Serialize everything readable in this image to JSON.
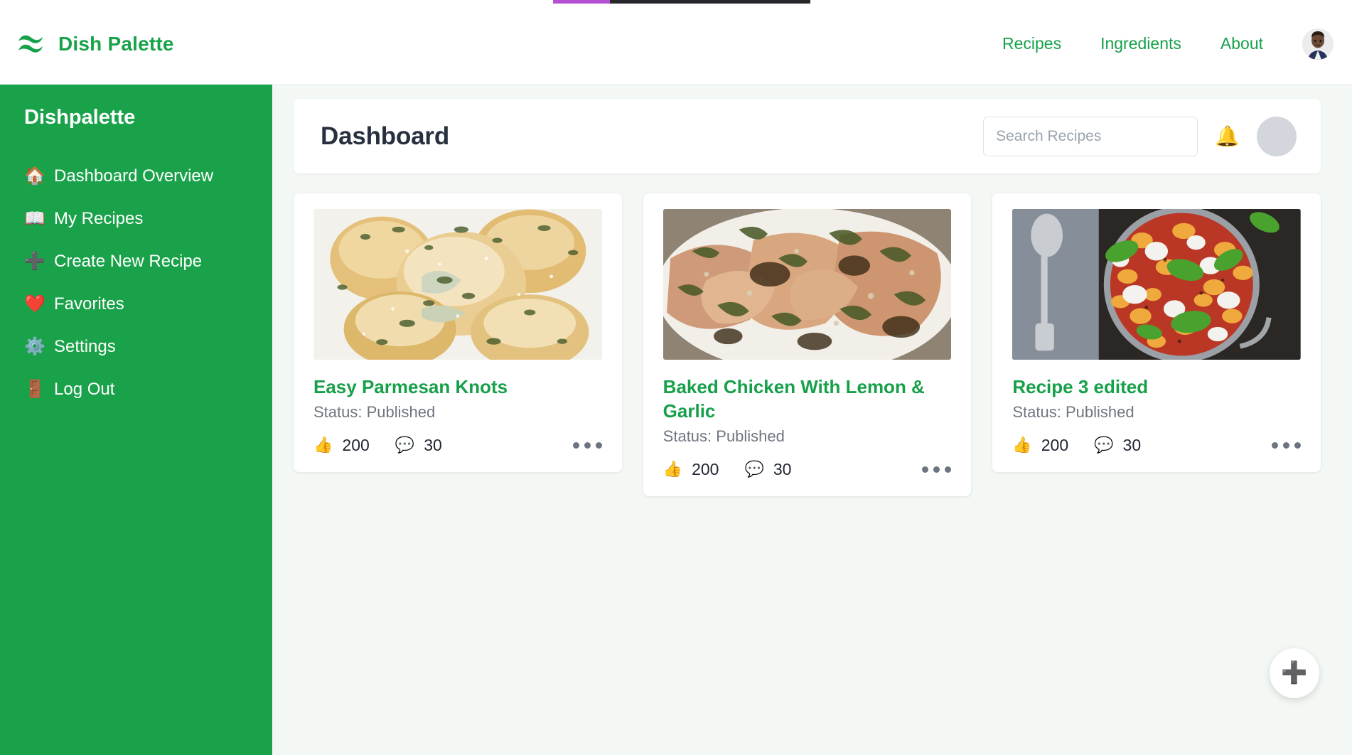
{
  "loading_bar": {
    "progress_percent": 22,
    "fill_color": "#b34fd0",
    "track_color": "#26262b"
  },
  "topnav": {
    "brand": "Dish Palette",
    "logo_icon": "wave-leaf-icon",
    "links": [
      {
        "label": "Recipes"
      },
      {
        "label": "Ingredients"
      },
      {
        "label": "About"
      }
    ],
    "avatar_icon": "user-photo-avatar"
  },
  "sidebar": {
    "title": "Dishpalette",
    "background_color": "#1aa24a",
    "items": [
      {
        "label": "Dashboard Overview",
        "icon": "house-icon",
        "glyph": "🏠"
      },
      {
        "label": "My Recipes",
        "icon": "open-book-icon",
        "glyph": "📖"
      },
      {
        "label": "Create New Recipe",
        "icon": "plus-icon",
        "glyph": "➕"
      },
      {
        "label": "Favorites",
        "icon": "heart-icon",
        "glyph": "❤️"
      },
      {
        "label": "Settings",
        "icon": "gear-icon",
        "glyph": "⚙️"
      },
      {
        "label": "Log Out",
        "icon": "door-icon",
        "glyph": "🚪"
      }
    ]
  },
  "header": {
    "title": "Dashboard",
    "search": {
      "placeholder": "Search Recipes",
      "value": ""
    },
    "bell_icon": "bell-icon",
    "bell_glyph": "🔔",
    "avatar_icon": "blank-avatar"
  },
  "recipes": [
    {
      "title": "Easy Parmesan Knots",
      "status": "Status: Published",
      "likes": "200",
      "comments": "30",
      "like_glyph": "👍",
      "comment_glyph": "💬",
      "image_alt": "parmesan-knots-photo",
      "menu_icon": "more-options-icon"
    },
    {
      "title": "Baked Chicken With Lemon & Garlic",
      "status": "Status: Published",
      "likes": "200",
      "comments": "30",
      "like_glyph": "👍",
      "comment_glyph": "💬",
      "image_alt": "baked-chicken-photo",
      "menu_icon": "more-options-icon"
    },
    {
      "title": "Recipe 3 edited",
      "status": "Status: Published",
      "likes": "200",
      "comments": "30",
      "like_glyph": "👍",
      "comment_glyph": "💬",
      "image_alt": "gnocchi-bake-photo",
      "menu_icon": "more-options-icon"
    }
  ],
  "fab": {
    "label": "➕",
    "icon": "add-recipe-icon"
  },
  "colors": {
    "brand_green": "#1aa24a",
    "link_green": "#16a04a",
    "title_navy": "#28303f",
    "status_gray": "#6e7680",
    "page_bg": "#f4f8f5"
  }
}
